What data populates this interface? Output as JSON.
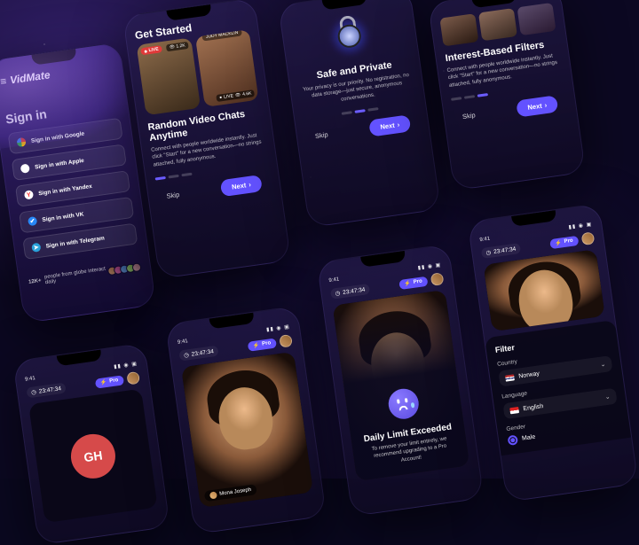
{
  "app": {
    "name": "VidMate"
  },
  "signin": {
    "title": "Sign in",
    "providers": [
      {
        "label": "Sign in with Google",
        "icon": "google"
      },
      {
        "label": "Sign in with Apple",
        "icon": "apple"
      },
      {
        "label": "Sign in with Yandex",
        "icon": "yandex"
      },
      {
        "label": "Sign in with VK",
        "icon": "vk"
      },
      {
        "label": "Sign in with Telegram",
        "icon": "telegram"
      }
    ],
    "daily_prefix": "12K+",
    "daily_text": "people from globe interact daily"
  },
  "onboarding": {
    "get_started": "Get Started",
    "next": "Next",
    "skip": "Skip",
    "chevron": "›",
    "screen1": {
      "tile_user": "JUDY MACKLIN",
      "live_badge": "LIVE",
      "live_small": "LIVE",
      "viewers1": "1.2K",
      "viewers2": "4.6K",
      "title": "Random Video Chats Anytime",
      "desc": "Connect with people worldwide instantly. Just click \"Start\" for a new conversation—no strings attached, fully anonymous."
    },
    "screen2": {
      "title": "Safe and Private",
      "desc": "Your privacy is our priority. No registration, no data storage—just secure, anonymous conversations."
    },
    "screen3": {
      "title": "Interest-Based Filters",
      "desc": "Connect with people worldwide instantly. Just click \"Start\" for a new conversation—no strings attached, fully anonymous."
    }
  },
  "chat": {
    "clock": "9:41",
    "timer": "23:47:34",
    "pro": "Pro",
    "placeholder_initials": "GH",
    "remote_name": "Mona Joseph"
  },
  "limit": {
    "title": "Daily Limit Exceeded",
    "desc": "To remove your limit entirely, we recommend upgrading to a Pro Account!"
  },
  "filter": {
    "title": "Filter",
    "country_label": "Country",
    "country_value": "Norway",
    "language_label": "Language",
    "language_value": "English",
    "gender_label": "Gender",
    "gender_value": "Male"
  }
}
